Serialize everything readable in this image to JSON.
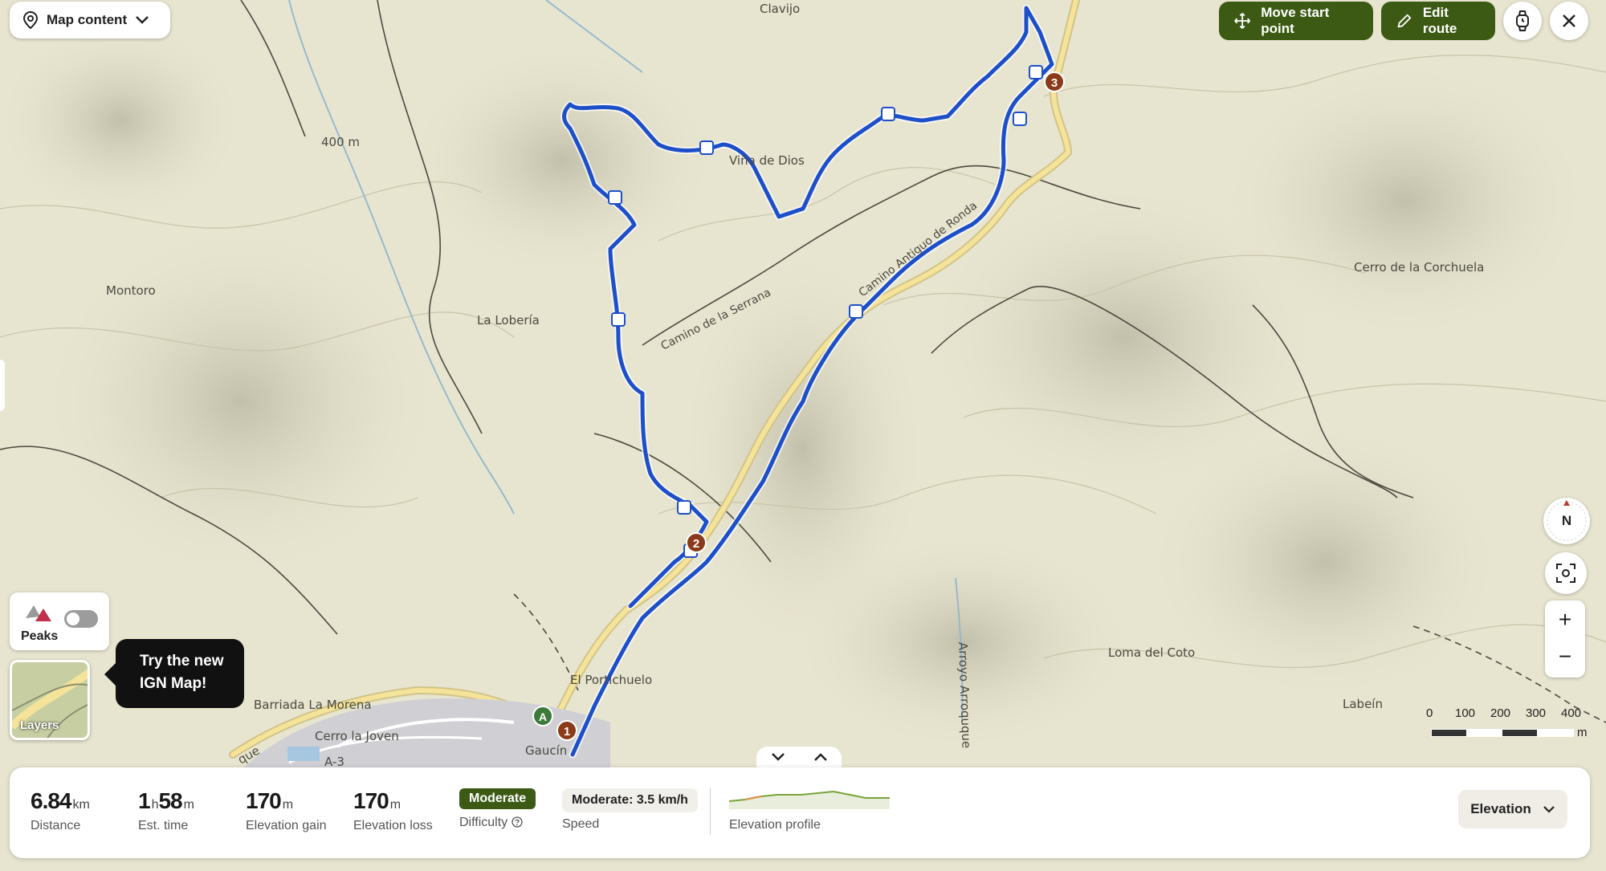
{
  "map_content": {
    "label": "Map content"
  },
  "toolbar": {
    "move_start": "Move start point",
    "edit_route": "Edit route"
  },
  "place_labels": {
    "clavijo": "Clavijo",
    "vina": "Viña de Dios",
    "montoro": "Montoro",
    "loberia": "La Lobería",
    "corchuela": "Cerro de la Corchuela",
    "loma": "Loma del Coto",
    "labein": "Labeín",
    "portichuelo": "El Portichuelo",
    "barriada": "Barriada La Morena",
    "cerro_joven": "Cerro la Joven",
    "gaucin": "Gaucín",
    "contour": "400 m",
    "road_a": "A-3",
    "road_que": "que",
    "arroyo": "Arroyo Arroquque"
  },
  "road_labels": {
    "serrana": "Camino de la Serrana",
    "ronda": "Camino Antiguo de Ronda"
  },
  "markers": {
    "start": "A",
    "p1": "1",
    "p2": "2",
    "p3": "3"
  },
  "peaks": {
    "label": "Peaks",
    "enabled": false
  },
  "layers": {
    "label": "Layers"
  },
  "tooltip": {
    "line1": "Try the new",
    "line2": "IGN Map!"
  },
  "compass": {
    "label": "N"
  },
  "zoom": {
    "in": "+",
    "out": "−"
  },
  "scale": {
    "ticks": [
      "0",
      "100",
      "200",
      "300",
      "400"
    ],
    "unit": "m"
  },
  "stats": {
    "distance": {
      "value": "6.84",
      "unit": "km",
      "label": "Distance"
    },
    "time": {
      "h": "1",
      "h_unit": "h",
      "m": "58",
      "m_unit": "m",
      "label": "Est. time"
    },
    "gain": {
      "value": "170",
      "unit": "m",
      "label": "Elevation gain"
    },
    "loss": {
      "value": "170",
      "unit": "m",
      "label": "Elevation loss"
    },
    "difficulty": {
      "value": "Moderate",
      "label": "Difficulty"
    },
    "speed": {
      "value": "Moderate: 3.5 km/h",
      "label": "Speed"
    },
    "profile": {
      "label": "Elevation profile"
    }
  },
  "elevation_button": {
    "label": "Elevation"
  },
  "colors": {
    "route": "#1d4fc9",
    "accent": "#3c5a14",
    "marker": "#8b3a1a",
    "road": "#f6e39a"
  }
}
